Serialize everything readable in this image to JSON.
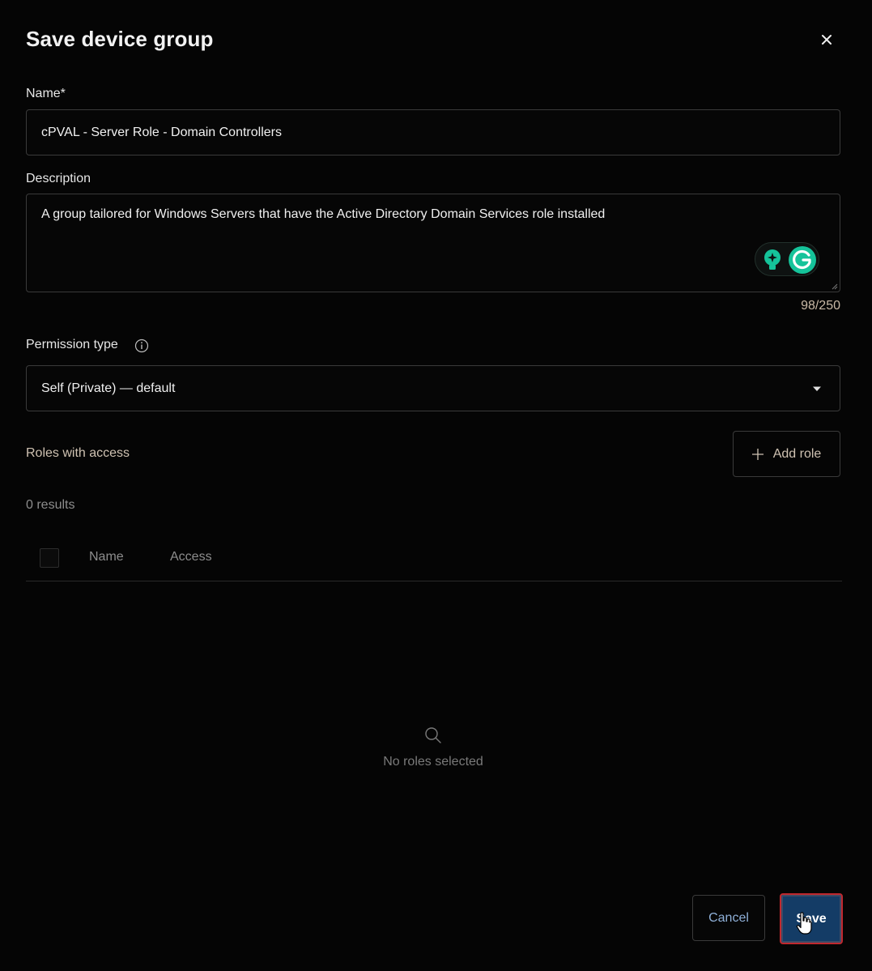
{
  "dialog": {
    "title": "Save device group",
    "close_icon": "close-icon"
  },
  "name_field": {
    "label": "Name*",
    "value": "cPVAL - Server Role - Domain Controllers"
  },
  "description_field": {
    "label": "Description",
    "value": "A group tailored for Windows Servers that have the Active Directory Domain Services role installed",
    "counter": "98/250"
  },
  "permission": {
    "label": "Permission type",
    "selected": "Self (Private) — default"
  },
  "roles": {
    "label": "Roles with access",
    "add_button": "Add role",
    "results": "0 results",
    "columns": [
      "Name",
      "Access"
    ],
    "empty_text": "No roles selected"
  },
  "footer": {
    "cancel_label": "Cancel",
    "save_label": "Save"
  },
  "colors": {
    "background": "#050505",
    "accent_text": "#cfc2b2",
    "save_bg": "#143c66",
    "cancel_text": "#8fb0d8",
    "grammarly_green": "#15c39a"
  }
}
